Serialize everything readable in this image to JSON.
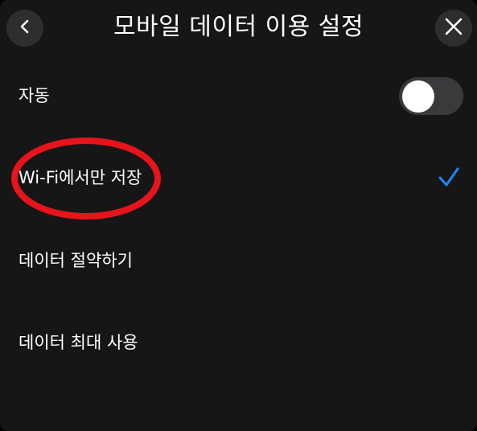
{
  "header": {
    "title": "모바일 데이터 이용 설정",
    "back_icon": "chevron-left-icon",
    "close_icon": "close-icon"
  },
  "settings": {
    "auto": {
      "label": "자동",
      "enabled": false
    },
    "options": [
      {
        "label": "Wi-Fi에서만 저장",
        "selected": true
      },
      {
        "label": "데이터 절약하기",
        "selected": false
      },
      {
        "label": "데이터 최대 사용",
        "selected": false
      }
    ]
  },
  "colors": {
    "background": "#161616",
    "button_bg": "#2e2e2e",
    "toggle_track": "#3a3a3c",
    "accent_check": "#1e88f5",
    "annotation_circle": "#e8131b"
  },
  "annotation": {
    "type": "red-ellipse",
    "target": "Wi-Fi에서만 저장"
  }
}
